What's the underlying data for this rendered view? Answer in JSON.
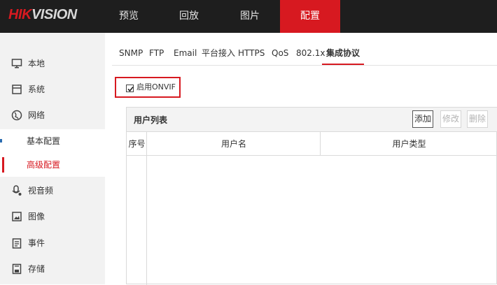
{
  "logo": {
    "part1": "HIK",
    "part2": "VISION"
  },
  "nav": [
    {
      "label": "预览"
    },
    {
      "label": "回放"
    },
    {
      "label": "图片"
    },
    {
      "label": "配置"
    }
  ],
  "sidebar": {
    "items": [
      {
        "label": "本地",
        "icon": "monitor-icon"
      },
      {
        "label": "系统",
        "icon": "system-icon"
      },
      {
        "label": "网络",
        "icon": "globe-icon"
      },
      {
        "label": "视音频",
        "icon": "audio-video-icon"
      },
      {
        "label": "图像",
        "icon": "image-icon"
      },
      {
        "label": "事件",
        "icon": "event-icon"
      },
      {
        "label": "存储",
        "icon": "storage-icon"
      }
    ],
    "network_sub": [
      {
        "label": "基本配置"
      },
      {
        "label": "高级配置"
      }
    ]
  },
  "tabs": [
    {
      "label": "SNMP"
    },
    {
      "label": "FTP"
    },
    {
      "label": "Email"
    },
    {
      "label": "平台接入"
    },
    {
      "label": "HTTPS"
    },
    {
      "label": "QoS"
    },
    {
      "label": "802.1x"
    },
    {
      "label": "集成协议"
    }
  ],
  "onvif": {
    "label": "启用ONVIF",
    "checked": true
  },
  "user_list": {
    "title": "用户列表",
    "buttons": {
      "add": "添加",
      "modify": "修改",
      "delete": "删除"
    },
    "columns": [
      "序号",
      "用户名",
      "用户类型"
    ],
    "rows": []
  },
  "colors": {
    "accent": "#d71920",
    "topbar": "#1e1e1e",
    "sidebar": "#f2f2f2"
  }
}
